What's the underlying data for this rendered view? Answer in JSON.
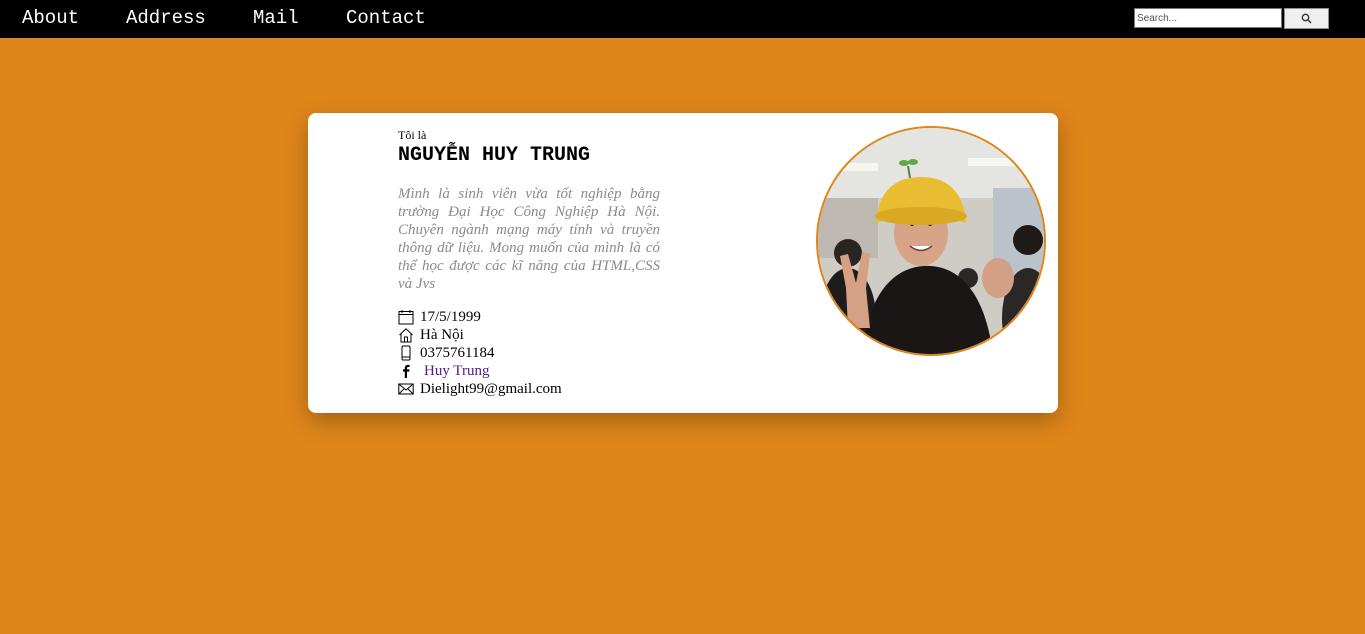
{
  "nav": {
    "links": [
      "About",
      "Address",
      "Mail",
      "Contact"
    ],
    "search_placeholder": "Search...",
    "search_icon": "search-icon"
  },
  "profile": {
    "intro": "Tôi là",
    "name": "NGUYỄN HUY TRUNG",
    "bio": "Mình là sinh viên vừa tốt nghiệp bằng trường Đại Học Công Nghiệp Hà Nội. Chuyên ngành mạng máy tính và truyền thông dữ liệu. Mong muốn của mình là có thể học được các kĩ năng của HTML,CSS và Jvs",
    "birthday": "17/5/1999",
    "address": "Hà Nội",
    "phone": "0375761184",
    "facebook": "Huy Trung",
    "email": "Dielight99@gmail.com"
  },
  "colors": {
    "background": "#df861a",
    "navbar": "#000000",
    "card": "#ffffff",
    "bio_text": "#8a8a8a",
    "link": "#551a8b"
  }
}
